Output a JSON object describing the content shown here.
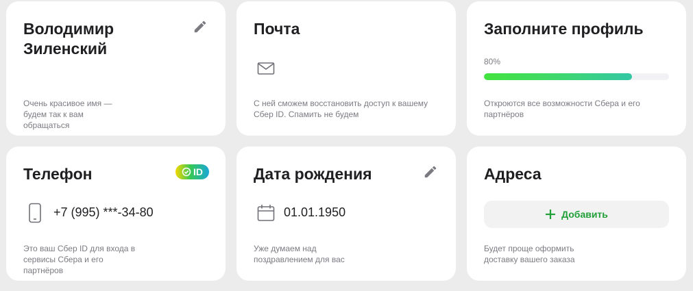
{
  "colors": {
    "accent_green": "#21a038",
    "progress_start": "#42e33f",
    "progress_end": "#33c7a4",
    "background": "#ececec",
    "card": "#ffffff"
  },
  "name_card": {
    "title": "Володимир Зиленский",
    "description": "Очень красивое имя — будем так к вам обращаться",
    "edit_icon": "pencil-icon"
  },
  "email_card": {
    "title": "Почта",
    "icon": "envelope-icon",
    "description": "С ней сможем восстановить доступ к вашему Сбер ID. Спамить не будем"
  },
  "profile_card": {
    "title": "Заполните профиль",
    "progress_label": "80%",
    "progress_value": 0.8,
    "description": "Откроются все возможности Сбера и его партнёров"
  },
  "phone_card": {
    "title": "Телефон",
    "badge_label": "ID",
    "icon": "phone-icon",
    "value": "+7 (995) ***-34-80",
    "description": "Это ваш Сбер ID для входа в сервисы Сбера и его партнёров"
  },
  "birthday_card": {
    "title": "Дата рождения",
    "icon": "calendar-icon",
    "value": "01.01.1950",
    "edit_icon": "pencil-icon",
    "description": "Уже думаем над поздравлением для вас"
  },
  "address_card": {
    "title": "Адреса",
    "add_label": "Добавить",
    "description": "Будет проще оформить доставку вашего заказа"
  }
}
